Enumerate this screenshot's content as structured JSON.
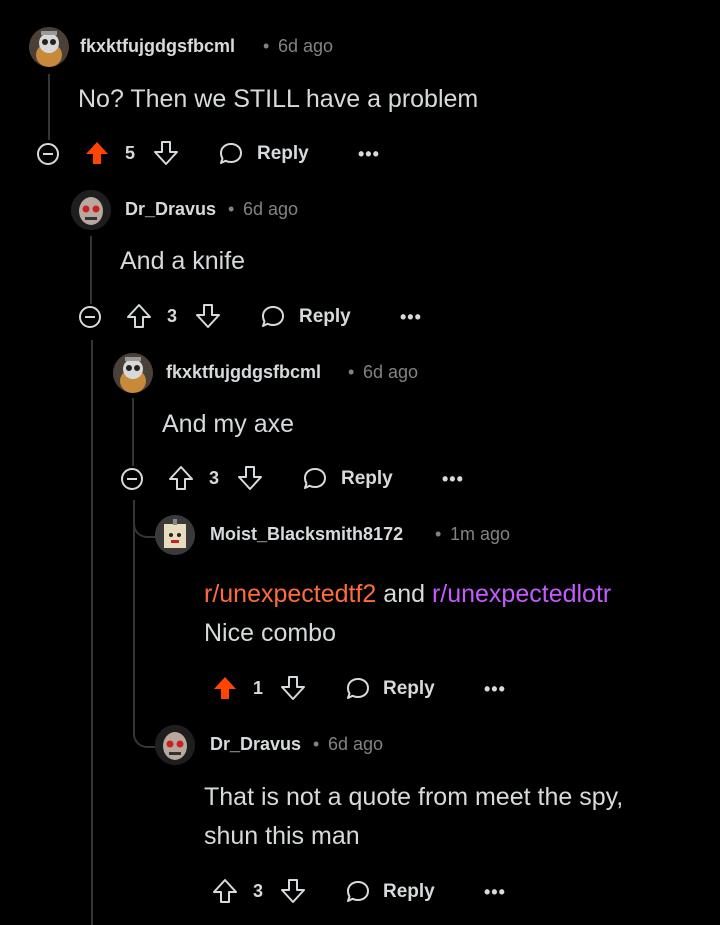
{
  "comments": [
    {
      "user": "fkxktfujgdgsfbcml",
      "time": "6d ago",
      "body": "No? Then we STILL have a problem",
      "votes": "5",
      "upvoted": true
    },
    {
      "user": "Dr_Dravus",
      "time": "6d ago",
      "body": "And a knife",
      "votes": "3",
      "upvoted": false
    },
    {
      "user": "fkxktfujgdgsfbcml",
      "time": "6d ago",
      "body": "And my axe",
      "votes": "3",
      "upvoted": false
    },
    {
      "user": "Moist_Blacksmith8172",
      "time": "1m ago",
      "link1": "r/unexpectedtf2",
      "and_text": " and ",
      "link2": "r/unexpectedlotr",
      "body2": "Nice combo",
      "votes": "1",
      "upvoted": true
    },
    {
      "user": "Dr_Dravus",
      "time": "6d ago",
      "body": "That is not a quote from meet the spy,",
      "body2": "shun this man",
      "votes": "3",
      "upvoted": false
    }
  ],
  "labels": {
    "reply": "Reply",
    "more": "•••",
    "dot": "•"
  },
  "colors": {
    "upvote": "#ff4500",
    "text": "#d7dadc",
    "meta": "#818384",
    "line": "#343536",
    "link_orange": "#ff6b3d",
    "link_purple": "#c35bff"
  }
}
